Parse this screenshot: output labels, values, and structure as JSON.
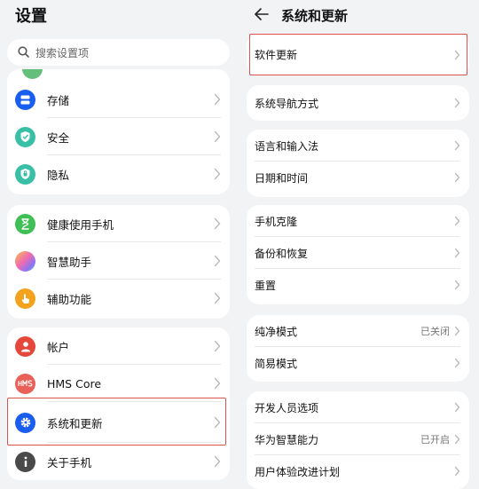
{
  "left": {
    "title": "设置",
    "search_placeholder": "搜索设置项",
    "groups": [
      [
        {
          "label": "存储",
          "icon": "storage-icon",
          "color": "#1a5ef0"
        },
        {
          "label": "安全",
          "icon": "shield-icon",
          "color": "#38bfa6"
        },
        {
          "label": "隐私",
          "icon": "privacy-shield-icon",
          "color": "#38bfa6"
        }
      ],
      [
        {
          "label": "健康使用手机",
          "icon": "hourglass-icon",
          "color": "#3fbf55"
        },
        {
          "label": "智慧助手",
          "icon": "assistant-orb-icon",
          "color": "#b26ee8"
        },
        {
          "label": "辅助功能",
          "icon": "hand-icon",
          "color": "#f2a21b"
        }
      ],
      [
        {
          "label": "帐户",
          "icon": "person-icon",
          "color": "#e5473a"
        },
        {
          "label": "HMS Core",
          "icon": "hms-core-icon",
          "color": "#e86058"
        },
        {
          "label": "系统和更新",
          "icon": "gear-icon",
          "color": "#1a5ef0"
        },
        {
          "label": "关于手机",
          "icon": "info-icon",
          "color": "#4a4a4a"
        }
      ]
    ]
  },
  "right": {
    "title": "系统和更新",
    "groups": [
      [
        {
          "label": "软件更新",
          "value": ""
        }
      ],
      [
        {
          "label": "系统导航方式",
          "value": ""
        }
      ],
      [
        {
          "label": "语言和输入法",
          "value": ""
        },
        {
          "label": "日期和时间",
          "value": ""
        }
      ],
      [
        {
          "label": "手机克隆",
          "value": ""
        },
        {
          "label": "备份和恢复",
          "value": ""
        },
        {
          "label": "重置",
          "value": ""
        }
      ],
      [
        {
          "label": "纯净模式",
          "value": "已关闭"
        },
        {
          "label": "简易模式",
          "value": ""
        }
      ],
      [
        {
          "label": "开发人员选项",
          "value": ""
        },
        {
          "label": "华为智慧能力",
          "value": "已开启"
        },
        {
          "label": "用户体验改进计划",
          "value": ""
        }
      ]
    ]
  },
  "colors": {
    "highlight": "#d9534f",
    "background": "#f1f3f5"
  }
}
